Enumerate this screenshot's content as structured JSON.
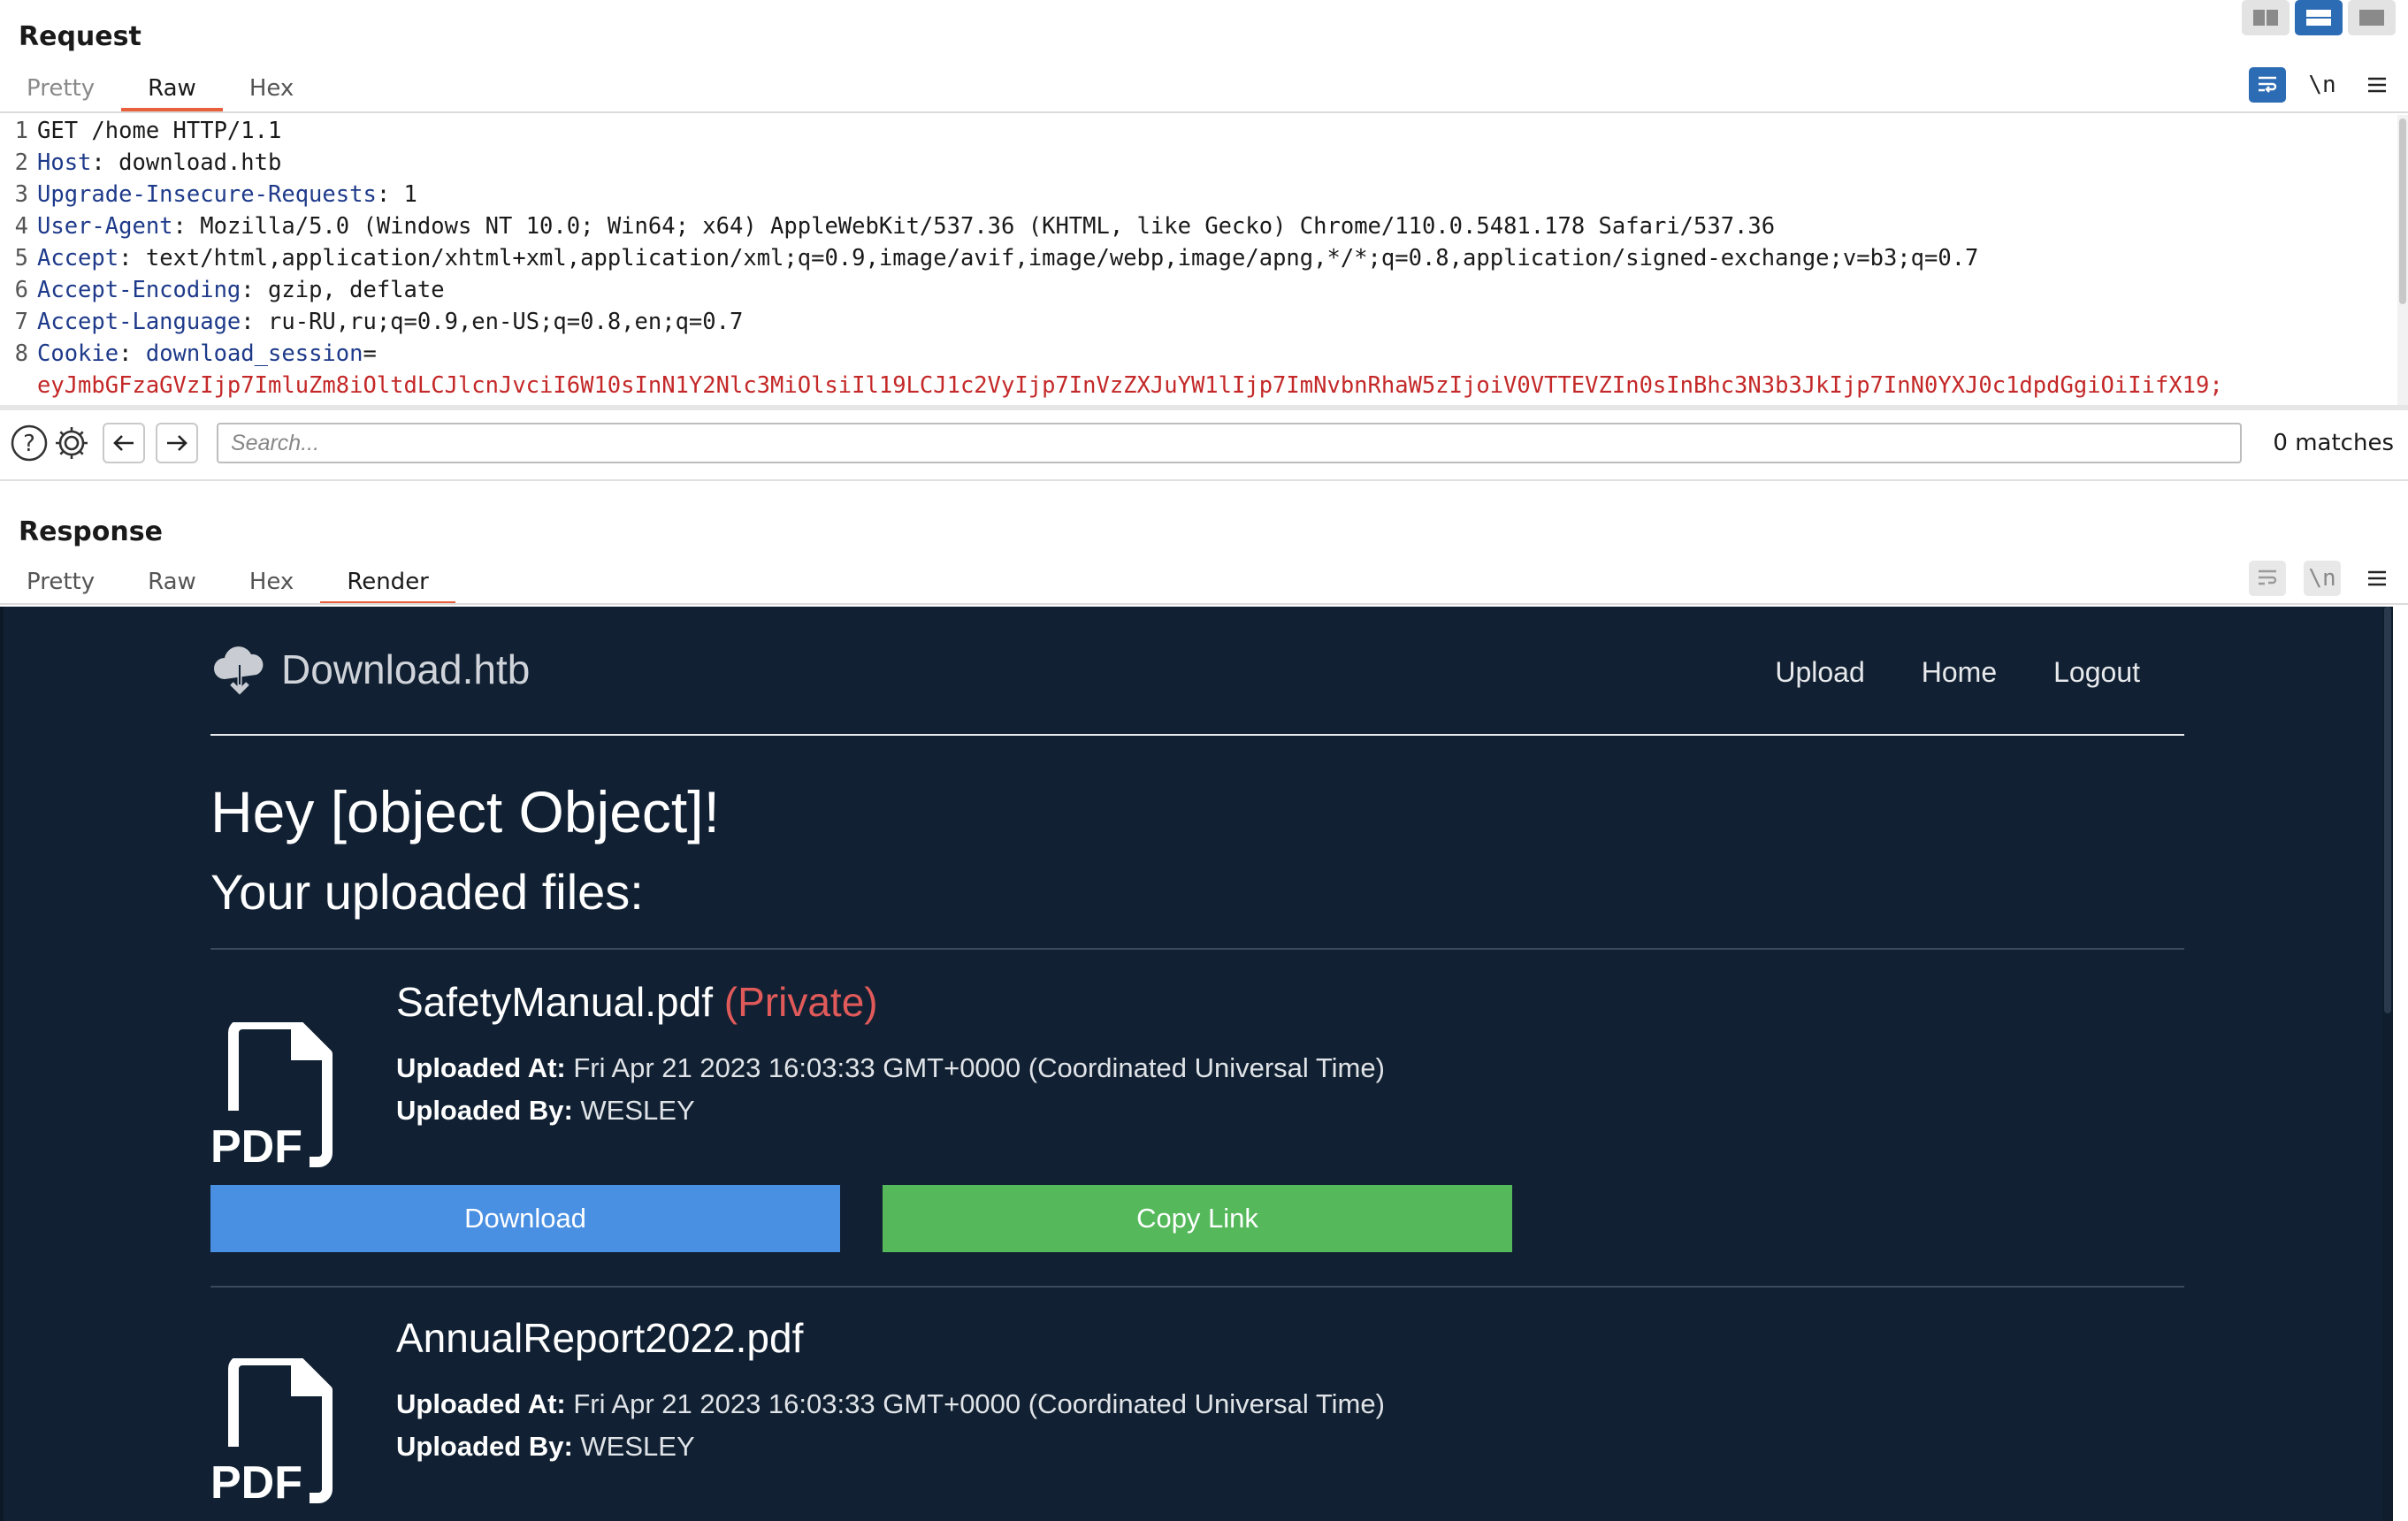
{
  "request": {
    "title": "Request",
    "tabs": [
      {
        "label": "Pretty"
      },
      {
        "label": "Raw"
      },
      {
        "label": "Hex"
      }
    ],
    "active_tab": "Raw",
    "toolbar": {
      "wrap_icon": "word-wrap-icon",
      "newline_label": "\\n",
      "menu_icon": "hamburger-menu-icon"
    },
    "lines": [
      {
        "num": "1",
        "key": "",
        "value": "GET /home HTTP/1.1"
      },
      {
        "num": "2",
        "key": "Host",
        "value": "download.htb"
      },
      {
        "num": "3",
        "key": "Upgrade-Insecure-Requests",
        "value": "1"
      },
      {
        "num": "4",
        "key": "User-Agent",
        "value": "Mozilla/5.0 (Windows NT 10.0; Win64; x64) AppleWebKit/537.36 (KHTML, like Gecko) Chrome/110.0.5481.178 Safari/537.36"
      },
      {
        "num": "5",
        "key": "Accept",
        "value": "text/html,application/xhtml+xml,application/xml;q=0.9,image/avif,image/webp,image/apng,*/*;q=0.8,application/signed-exchange;v=b3;q=0.7"
      },
      {
        "num": "6",
        "key": "Accept-Encoding",
        "value": "gzip, deflate"
      },
      {
        "num": "7",
        "key": "Accept-Language",
        "value": "ru-RU,ru;q=0.9,en-US;q=0.8,en;q=0.7"
      },
      {
        "num": "8",
        "key": "Cookie",
        "value": ""
      }
    ],
    "cookie_name": "download_session",
    "cookie_value": "eyJmbGFzaGVzIjp7ImluZm8iOltdLCJlcnJvciI6W10sInN1Y2Nlc3MiOlsiIl19LCJ1c2VyIjp7InVzZXJuYW1lIjp7ImNvbnRhaW5zIjoiV0VTTEVZIn0sInBhc3N3b3JkIjp7InN0YXJ0c1dpdGgiOiIifX19;"
  },
  "search": {
    "placeholder": "Search...",
    "matches": "0 matches"
  },
  "response": {
    "title": "Response",
    "tabs": [
      {
        "label": "Pretty"
      },
      {
        "label": "Raw"
      },
      {
        "label": "Hex"
      },
      {
        "label": "Render"
      }
    ],
    "active_tab": "Render"
  },
  "site": {
    "brand": "Download.htb",
    "nav": [
      "Upload",
      "Home",
      "Logout"
    ],
    "greeting": "Hey [object Object]!",
    "subheading": "Your uploaded files:",
    "uploaded_at_label": "Uploaded At:",
    "uploaded_by_label": "Uploaded By:",
    "files": [
      {
        "name": "SafetyManual.pdf",
        "private": "(Private)",
        "uploaded_at": "Fri Apr 21 2023 16:03:33 GMT+0000 (Coordinated Universal Time)",
        "uploaded_by": "WESLEY",
        "download_label": "Download",
        "copy_label": "Copy Link"
      },
      {
        "name": "AnnualReport2022.pdf",
        "private": "",
        "uploaded_at": "Fri Apr 21 2023 16:03:33 GMT+0000 (Coordinated Universal Time)",
        "uploaded_by": "WESLEY"
      }
    ],
    "file_icon_label": "PDF",
    "colors": {
      "background": "#112133",
      "download": "#4a90e2",
      "copy": "#55b95c",
      "private": "#e05a5a"
    }
  }
}
